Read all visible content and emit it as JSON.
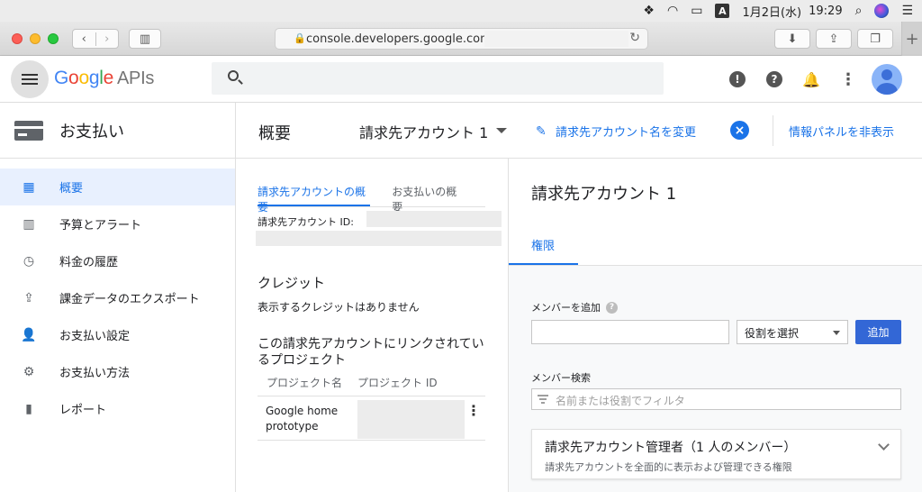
{
  "menubar": {
    "date": "1月2日(水)",
    "time": "19:29",
    "input_badge": "A"
  },
  "browser": {
    "url": "console.developers.google.com/",
    "icons": [
      "dropbox-icon",
      "wifi-icon",
      "airplay-icon",
      "search-icon",
      "siri-icon",
      "list-icon"
    ]
  },
  "header": {
    "logo_google": "Google",
    "logo_apis": "APIs",
    "colors": {
      "blue": "#4285f4",
      "red": "#ea4335",
      "yellow": "#fbbc05",
      "green": "#34a853"
    }
  },
  "sidebar": {
    "title": "お支払い",
    "items": [
      {
        "label": "概要",
        "icon": "dashboard-icon",
        "active": true
      },
      {
        "label": "予算とアラート",
        "icon": "budget-icon"
      },
      {
        "label": "料金の履歴",
        "icon": "history-icon"
      },
      {
        "label": "課金データのエクスポート",
        "icon": "export-icon"
      },
      {
        "label": "お支払い設定",
        "icon": "person-icon"
      },
      {
        "label": "お支払い方法",
        "icon": "gear-icon"
      },
      {
        "label": "レポート",
        "icon": "bar-chart-icon"
      }
    ]
  },
  "pagehead": {
    "title": "概要",
    "account": "請求先アカウント 1",
    "rename": "請求先アカウント名を変更",
    "hide_panel": "情報パネルを非表示"
  },
  "overview": {
    "tabs": [
      "請求先アカウントの概要",
      "お支払いの概要"
    ],
    "account_id_label": "請求先アカウント ID:",
    "credit_heading": "クレジット",
    "credit_text": "表示するクレジットはありません",
    "linked_heading": "この請求先アカウントにリンクされているプロジェクト",
    "table_headers": [
      "プロジェクト名",
      "プロジェクト ID"
    ],
    "rows": [
      {
        "name": "Google home prototype"
      }
    ]
  },
  "panel": {
    "title": "請求先アカウント 1",
    "tab": "権限",
    "add_member_label": "メンバーを追加",
    "role_select": "役割を選択",
    "add_button": "追加",
    "search_label": "メンバー検索",
    "filter_placeholder": "名前または役割でフィルタ",
    "admin_title": "請求先アカウント管理者（1 人のメンバー）",
    "admin_desc": "請求先アカウントを全面的に表示および管理できる権限"
  },
  "colors": {
    "accent": "#1a73e8",
    "active_bg": "#e8f0fe",
    "button": "#3367d6"
  }
}
